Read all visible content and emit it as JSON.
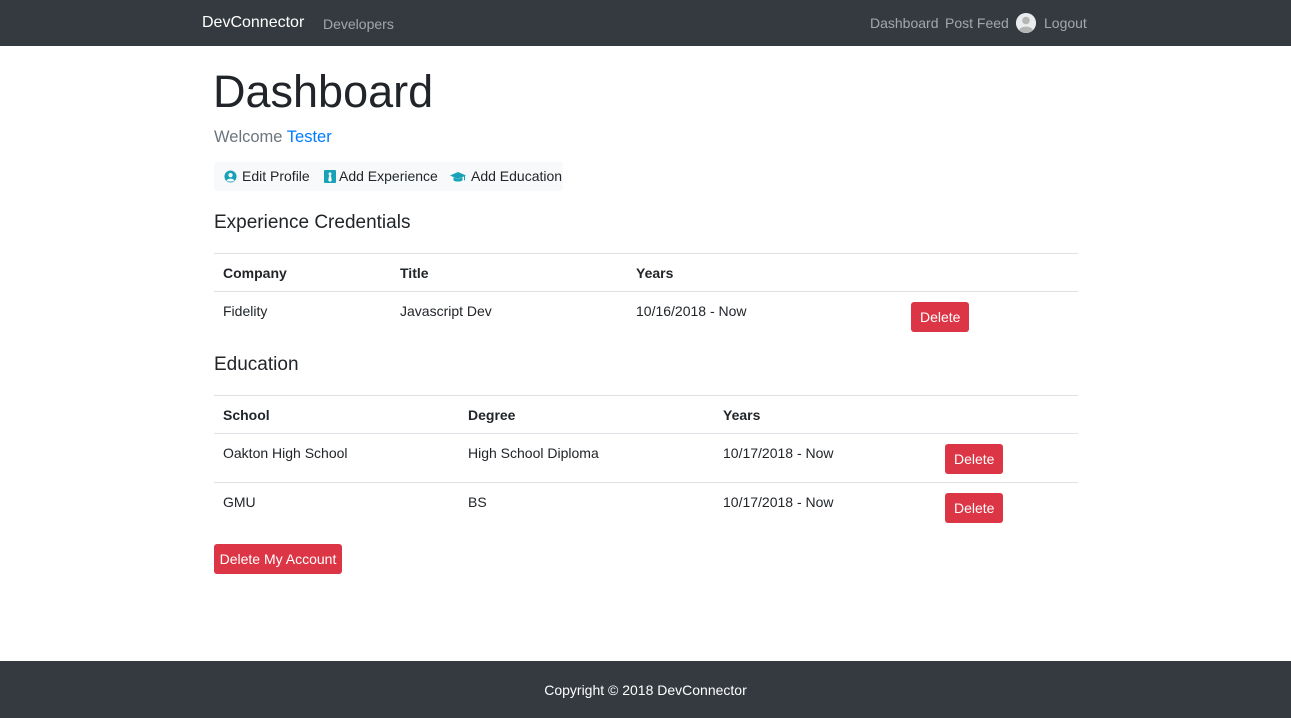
{
  "navbar": {
    "brand": "DevConnector",
    "developers": "Developers",
    "dashboard": "Dashboard",
    "post_feed": "Post Feed",
    "logout": "Logout"
  },
  "page": {
    "title": "Dashboard",
    "welcome_prefix": "Welcome ",
    "user_name": "Tester"
  },
  "actions": {
    "edit_profile": "Edit Profile",
    "add_experience": "Add Experience",
    "add_education": "Add Education"
  },
  "experience": {
    "title": "Experience Credentials",
    "headers": [
      "Company",
      "Title",
      "Years"
    ],
    "rows": [
      {
        "company": "Fidelity",
        "title": "Javascript Dev",
        "years": "10/16/2018 - Now",
        "delete": "Delete"
      }
    ]
  },
  "education": {
    "title": "Education",
    "headers": [
      "School",
      "Degree",
      "Years"
    ],
    "rows": [
      {
        "school": "Oakton High School",
        "degree": "High School Diploma",
        "years": "10/17/2018 - Now",
        "delete": "Delete"
      },
      {
        "school": "GMU",
        "degree": "BS",
        "years": "10/17/2018 - Now",
        "delete": "Delete"
      }
    ]
  },
  "delete_account": "Delete My Account",
  "footer": {
    "text": "Copyright © 2018 DevConnector"
  },
  "colors": {
    "navbar_bg": "#343a40",
    "accent_blue": "#007bff",
    "info_teal": "#17a2b8",
    "danger": "#dc3545"
  },
  "icons": {
    "edit_profile": "user-circle-icon",
    "add_experience": "black-tie-icon",
    "add_education": "graduation-cap-icon",
    "avatar": "avatar-icon"
  }
}
